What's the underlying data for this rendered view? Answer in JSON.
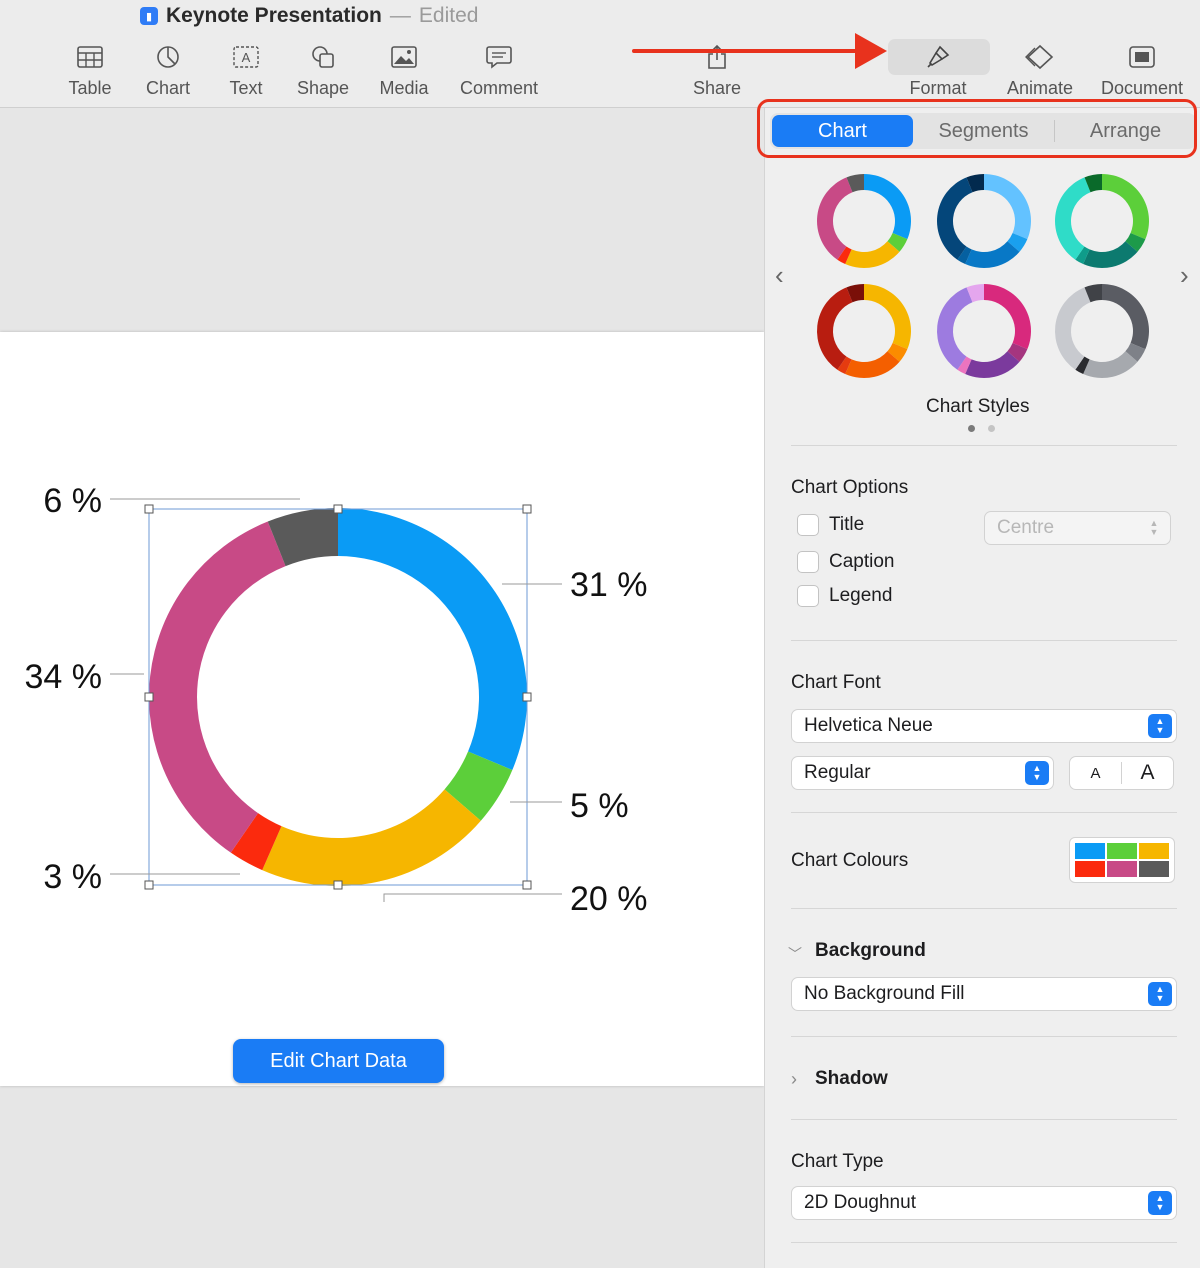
{
  "window": {
    "title": "Keynote Presentation",
    "separator": "—",
    "status": "Edited"
  },
  "toolbar": {
    "items": [
      {
        "label": "Table",
        "icon": "table-icon"
      },
      {
        "label": "Chart",
        "icon": "chart-icon"
      },
      {
        "label": "Text",
        "icon": "text-icon"
      },
      {
        "label": "Shape",
        "icon": "shape-icon"
      },
      {
        "label": "Media",
        "icon": "media-icon"
      },
      {
        "label": "Comment",
        "icon": "comment-icon"
      },
      {
        "label": "Share",
        "icon": "share-icon"
      },
      {
        "label": "Format",
        "icon": "paintbrush-icon"
      },
      {
        "label": "Animate",
        "icon": "animate-icon"
      },
      {
        "label": "Document",
        "icon": "document-icon"
      }
    ]
  },
  "inspector": {
    "tabs": [
      {
        "label": "Chart",
        "active": true
      },
      {
        "label": "Segments",
        "active": false
      },
      {
        "label": "Arrange",
        "active": false
      }
    ],
    "chart_styles_label": "Chart Styles",
    "chart_options": {
      "heading": "Chart Options",
      "title_label": "Title",
      "caption_label": "Caption",
      "legend_label": "Legend",
      "title_position": "Centre"
    },
    "chart_font": {
      "heading": "Chart Font",
      "family": "Helvetica Neue",
      "weight": "Regular",
      "size_small": "A",
      "size_large": "A"
    },
    "chart_colours": {
      "heading": "Chart Colours",
      "swatches": [
        "#0a9bf5",
        "#5ccf3a",
        "#f6b600",
        "#fb2a0d",
        "#c84a86",
        "#5a5a5a"
      ]
    },
    "background": {
      "heading": "Background",
      "fill": "No Background Fill"
    },
    "shadow": {
      "heading": "Shadow"
    },
    "chart_type": {
      "heading": "Chart Type",
      "value": "2D Doughnut"
    }
  },
  "canvas": {
    "edit_button": "Edit Chart Data"
  },
  "chart_data": {
    "type": "pie",
    "variant": "doughnut",
    "slices": [
      {
        "value": 31,
        "label": "31 %",
        "color": "#0a9bf5"
      },
      {
        "value": 5,
        "label": "5 %",
        "color": "#5ccf3a"
      },
      {
        "value": 20,
        "label": "20 %",
        "color": "#f6b600"
      },
      {
        "value": 3,
        "label": "3 %",
        "color": "#fb2a0d"
      },
      {
        "value": 34,
        "label": "34 %",
        "color": "#c84a86"
      },
      {
        "value": 6,
        "label": "6 %",
        "color": "#5a5a5a"
      }
    ]
  },
  "style_presets": [
    [
      "#0a9bf5",
      "#5ccf3a",
      "#f6b600",
      "#fb2a0d",
      "#c84a86",
      "#5a5a5a"
    ],
    [
      "#63c2ff",
      "#1aa0ee",
      "#0878c6",
      "#0560a0",
      "#04467a",
      "#022a4e"
    ],
    [
      "#5ccf3a",
      "#1d9a4a",
      "#0c7a6f",
      "#0f9c8a",
      "#2fdcc8",
      "#0a6a2a"
    ],
    [
      "#f6b600",
      "#fb8c00",
      "#f45f00",
      "#e53b10",
      "#b81d10",
      "#7a0f08"
    ],
    [
      "#d8297d",
      "#a5357f",
      "#7b3a9d",
      "#ec74bf",
      "#9d7be0",
      "#e4a6ee"
    ],
    [
      "#5a5c63",
      "#7e8188",
      "#a6a9ae",
      "#2a2b2f",
      "#c8cacf",
      "#404247"
    ]
  ]
}
